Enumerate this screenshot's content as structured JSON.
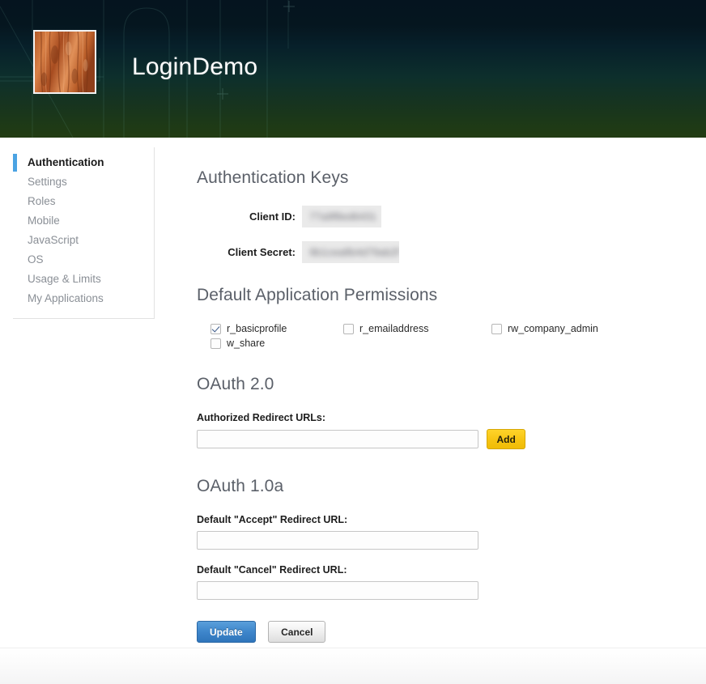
{
  "header": {
    "app_title": "LoginDemo",
    "logo_alt": "app-logo-bark-texture"
  },
  "sidebar": {
    "items": [
      {
        "label": "Authentication",
        "active": true
      },
      {
        "label": "Settings",
        "active": false
      },
      {
        "label": "Roles",
        "active": false
      },
      {
        "label": "Mobile",
        "active": false
      },
      {
        "label": "JavaScript",
        "active": false
      },
      {
        "label": "OS",
        "active": false
      },
      {
        "label": "Usage & Limits",
        "active": false
      },
      {
        "label": "My Applications",
        "active": false
      }
    ]
  },
  "auth_keys": {
    "title": "Authentication Keys",
    "client_id": {
      "label": "Client ID:",
      "value": "77a9f8ed6431",
      "redacted": true
    },
    "client_secret": {
      "label": "Client Secret:",
      "value": "9b1cea8b4d79ab2f",
      "redacted": true
    }
  },
  "permissions": {
    "title": "Default Application Permissions",
    "items": [
      {
        "name": "r_basicprofile",
        "checked": true,
        "col": 0,
        "row": 0
      },
      {
        "name": "w_share",
        "checked": false,
        "col": 0,
        "row": 1
      },
      {
        "name": "r_emailaddress",
        "checked": false,
        "col": 1,
        "row": 0
      },
      {
        "name": "rw_company_admin",
        "checked": false,
        "col": 2,
        "row": 0
      }
    ]
  },
  "oauth2": {
    "title": "OAuth 2.0",
    "redirect_label": "Authorized Redirect URLs:",
    "redirect_value": "",
    "redirect_placeholder": "",
    "add_label": "Add"
  },
  "oauth1": {
    "title": "OAuth 1.0a",
    "accept_label": "Default \"Accept\" Redirect URL:",
    "accept_value": "",
    "cancel_label": "Default \"Cancel\" Redirect URL:",
    "cancel_value": ""
  },
  "actions": {
    "update_label": "Update",
    "cancel_label": "Cancel"
  },
  "colors": {
    "accent_blue": "#4ba3e3",
    "add_yellow": "#f6c412",
    "update_blue": "#3e86cb",
    "heading_gray": "#5b6069",
    "header_top": "#05141f",
    "header_bottom": "#233c13"
  }
}
